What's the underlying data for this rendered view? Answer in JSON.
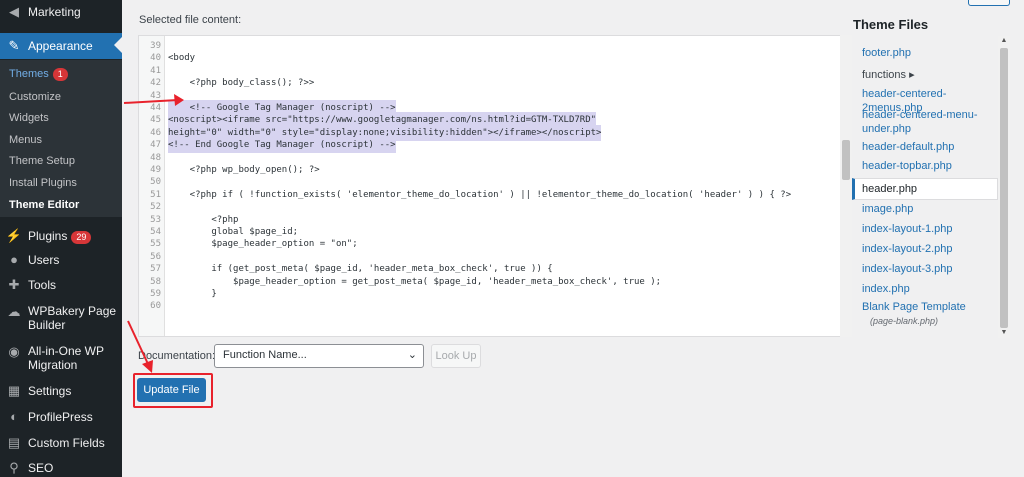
{
  "sidebar": {
    "items": [
      {
        "label": "Marketing",
        "icon": "megaphone-icon"
      },
      {
        "label": "Appearance",
        "icon": "paintbrush-icon"
      },
      {
        "label": "Plugins",
        "icon": "plug-icon",
        "badge": "29"
      },
      {
        "label": "Users",
        "icon": "users-icon"
      },
      {
        "label": "Tools",
        "icon": "wrench-icon"
      },
      {
        "label": "WPBakery Page Builder",
        "icon": "cloud-icon"
      },
      {
        "label": "All-in-One WP Migration",
        "icon": "migration-icon"
      },
      {
        "label": "Settings",
        "icon": "settings-icon"
      },
      {
        "label": "ProfilePress",
        "icon": "profile-icon"
      },
      {
        "label": "Custom Fields",
        "icon": "table-icon"
      },
      {
        "label": "SEO",
        "icon": "search-icon"
      }
    ],
    "submenu": [
      {
        "label": "Themes",
        "badge": "1"
      },
      {
        "label": "Customize"
      },
      {
        "label": "Widgets"
      },
      {
        "label": "Menus"
      },
      {
        "label": "Theme Setup"
      },
      {
        "label": "Install Plugins"
      },
      {
        "label": "Theme Editor"
      }
    ]
  },
  "main": {
    "selected_label": "Selected file content:",
    "doc_label": "Documentation:",
    "doc_select_value": "Function Name...",
    "lookup_label": "Look Up",
    "update_label": "Update File"
  },
  "code": [
    {
      "n": "39",
      "t": ""
    },
    {
      "n": "40",
      "t": "<body"
    },
    {
      "n": "41",
      "t": ""
    },
    {
      "n": "42",
      "t": "    <?php body_class(); ?>>"
    },
    {
      "n": "43",
      "t": ""
    },
    {
      "n": "44",
      "t": "    <!-- Google Tag Manager (noscript) -->"
    },
    {
      "n": "45",
      "t": "<noscript><iframe src=\"https://www.googletagmanager.com/ns.html?id=GTM-TXLD7RD\""
    },
    {
      "n": "46",
      "t": "height=\"0\" width=\"0\" style=\"display:none;visibility:hidden\"></iframe></noscript>"
    },
    {
      "n": "47",
      "t": "<!-- End Google Tag Manager (noscript) -->"
    },
    {
      "n": "48",
      "t": ""
    },
    {
      "n": "49",
      "t": "    <?php wp_body_open(); ?>"
    },
    {
      "n": "50",
      "t": ""
    },
    {
      "n": "51",
      "t": "    <?php if ( !function_exists( 'elementor_theme_do_location' ) || !elementor_theme_do_location( 'header' ) ) { ?>"
    },
    {
      "n": "52",
      "t": ""
    },
    {
      "n": "53",
      "t": "        <?php"
    },
    {
      "n": "54",
      "t": "        global $page_id;"
    },
    {
      "n": "55",
      "t": "        $page_header_option = \"on\";"
    },
    {
      "n": "56",
      "t": ""
    },
    {
      "n": "57",
      "t": "        if (get_post_meta( $page_id, 'header_meta_box_check', true )) {"
    },
    {
      "n": "58",
      "t": "            $page_header_option = get_post_meta( $page_id, 'header_meta_box_check', true );"
    },
    {
      "n": "59",
      "t": "        }"
    },
    {
      "n": "60",
      "t": ""
    }
  ],
  "files": {
    "title": "Theme Files",
    "items": [
      {
        "label": "footer.php"
      },
      {
        "label": "functions ▸",
        "dark": true
      },
      {
        "label": "header-centered-2menus.php"
      },
      {
        "label": "header-centered-menu-under.php"
      },
      {
        "label": "header-default.php"
      },
      {
        "label": "header-topbar.php"
      },
      {
        "label": "header.php",
        "current": true
      },
      {
        "label": "image.php"
      },
      {
        "label": "index-layout-1.php"
      },
      {
        "label": "index-layout-2.php"
      },
      {
        "label": "index-layout-3.php"
      },
      {
        "label": "index.php"
      },
      {
        "label": "Blank Page Template",
        "sub": "(page-blank.php)"
      }
    ]
  },
  "colors": {
    "accent": "#2271b1",
    "sidebar": "#1d2327",
    "annotation": "#e8222c"
  }
}
